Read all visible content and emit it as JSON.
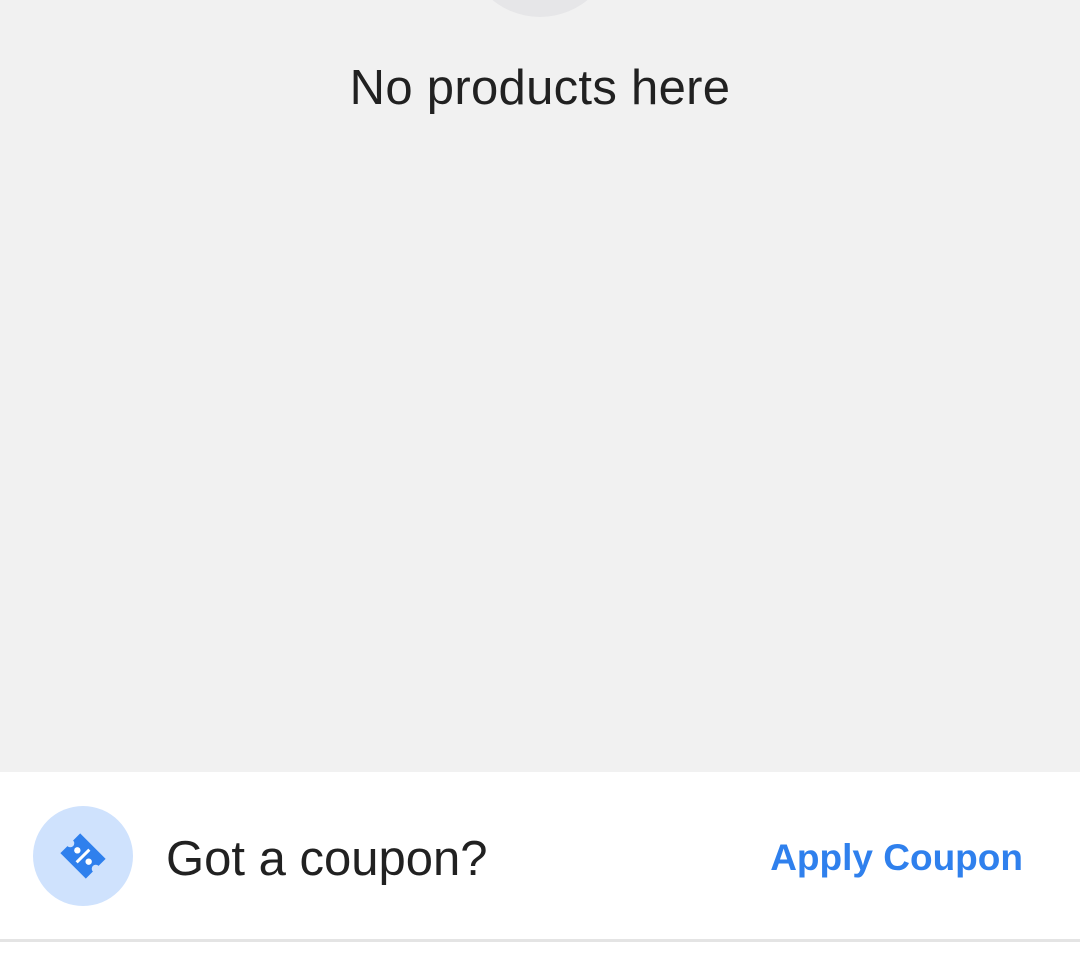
{
  "empty_state": {
    "title": "No products here"
  },
  "coupon": {
    "icon": "coupon-ticket-icon",
    "question": "Got a coupon?",
    "action_label": "Apply Coupon"
  },
  "colors": {
    "accent": "#2f80ed",
    "icon_background": "#cfe2fd",
    "page_background": "#f1f1f1"
  }
}
